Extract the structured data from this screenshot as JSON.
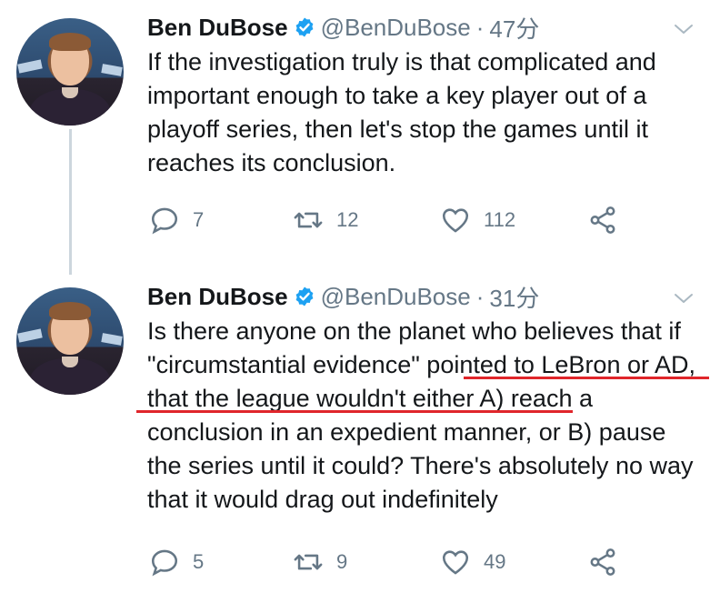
{
  "tweets": [
    {
      "name": "Ben DuBose",
      "handle": "@BenDuBose",
      "separator": "·",
      "time": "47分",
      "text": "If the investigation truly is that complicated and important enough to take a key player out of a playoff series, then let's stop the games until it reaches its conclusion.",
      "reply_count": "7",
      "retweet_count": "12",
      "like_count": "112"
    },
    {
      "name": "Ben DuBose",
      "handle": "@BenDuBose",
      "separator": "·",
      "time": "31分",
      "text": "Is there anyone on the planet who believes that if \"circumstantial evidence\" pointed to LeBron or AD, that the league wouldn't either A) reach a conclusion in an expedient manner, or B) pause the series until it could? There's absolutely no way that it would drag out indefinitely",
      "reply_count": "5",
      "retweet_count": "9",
      "like_count": "49"
    }
  ],
  "colors": {
    "text": "#14171a",
    "secondary": "#657786",
    "verified": "#1da1f2",
    "thread_line": "#ccd6dd",
    "highlight_underline": "#e0262b"
  },
  "icons": [
    "verified-badge-icon",
    "chevron-down-icon",
    "reply-icon",
    "retweet-icon",
    "like-icon",
    "share-icon"
  ]
}
